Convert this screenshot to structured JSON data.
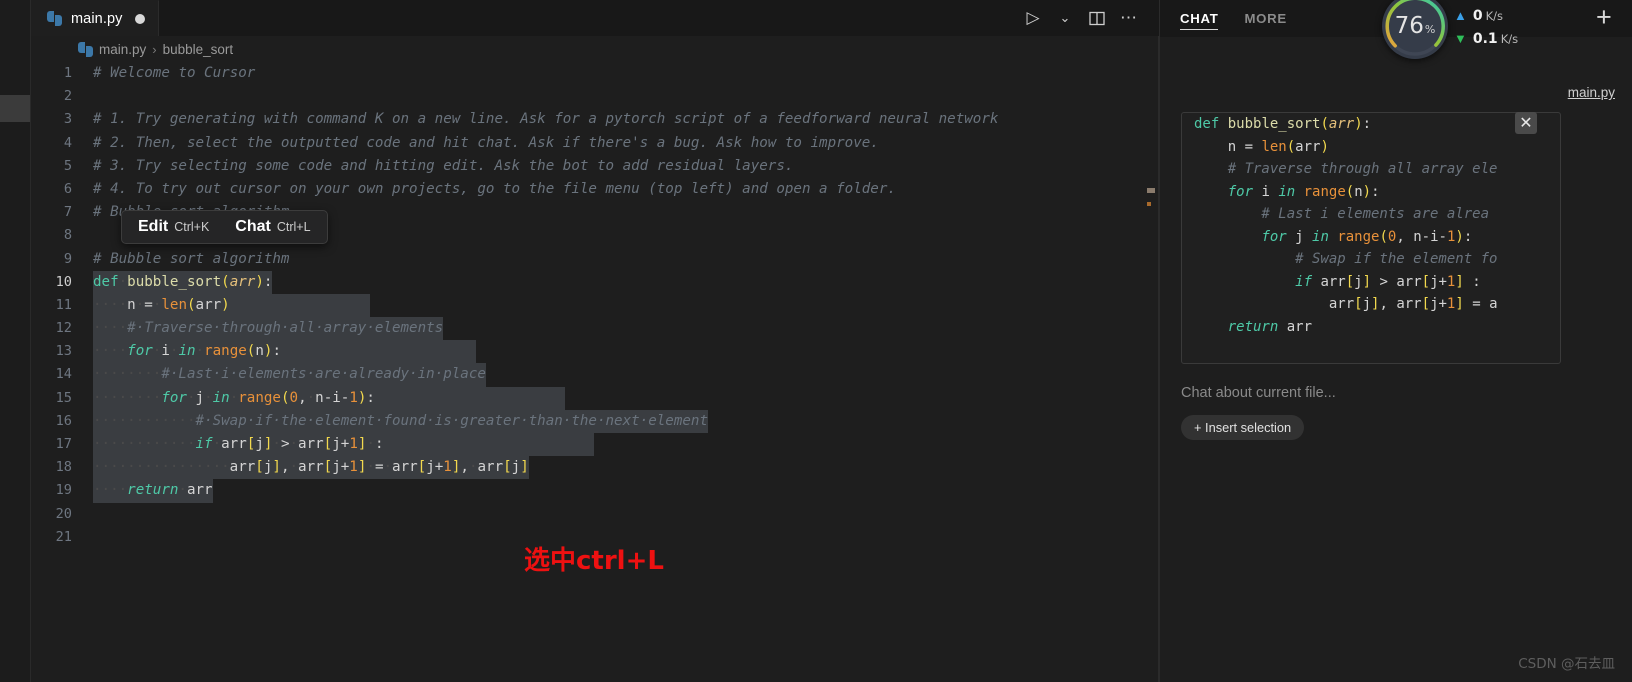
{
  "tab": {
    "label": "main.py",
    "icon": "python-file-icon",
    "dirty": true
  },
  "tabbar_actions": [
    {
      "name": "run-button",
      "glyph": "▷"
    },
    {
      "name": "chevron-down-icon",
      "glyph": "⌄"
    },
    {
      "name": "split-editor-icon",
      "glyph": "▥"
    },
    {
      "name": "more-actions-icon",
      "glyph": "⋯"
    }
  ],
  "breadcrumb": {
    "file": "main.py",
    "separator": "›",
    "symbol": "bubble_sort"
  },
  "editor": {
    "lines": [
      {
        "n": "1",
        "segs": [
          {
            "t": "# Welcome to Cursor",
            "c": "c-com"
          }
        ]
      },
      {
        "n": "2",
        "segs": []
      },
      {
        "n": "3",
        "segs": [
          {
            "t": "# 1. Try generating with command K on a new line. Ask for a pytorch script of a feedforward neural network",
            "c": "c-com"
          }
        ]
      },
      {
        "n": "4",
        "segs": [
          {
            "t": "# 2. Then, select the outputted code and hit chat. Ask if there's a bug. Ask how to improve.",
            "c": "c-com"
          }
        ]
      },
      {
        "n": "5",
        "segs": [
          {
            "t": "# 3. Try selecting some code and hitting edit. Ask the bot to add residual layers.",
            "c": "c-com"
          }
        ]
      },
      {
        "n": "6",
        "segs": [
          {
            "t": "# 4. To try out cursor on your own projects, go to the file menu (top left) and open a folder.",
            "c": "c-com"
          }
        ]
      },
      {
        "n": "7",
        "segs": [
          {
            "t": "# Bubble sort algorithm",
            "c": "c-com"
          }
        ]
      },
      {
        "n": "8",
        "segs": []
      },
      {
        "n": "9",
        "segs": [
          {
            "t": "# Bubble sort algorithm",
            "c": "c-com"
          }
        ]
      },
      {
        "n": "10",
        "current": true,
        "sel": true,
        "segs": [
          {
            "t": "def",
            "c": "c-def"
          },
          {
            "t": "·",
            "c": "ws"
          },
          {
            "t": "bubble_sort",
            "c": "c-fn"
          },
          {
            "t": "(",
            "c": "c-brk"
          },
          {
            "t": "arr",
            "c": "c-param"
          },
          {
            "t": ")",
            "c": "c-brk"
          },
          {
            "t": ":",
            "c": "c-plain"
          }
        ]
      },
      {
        "n": "11",
        "sel": true,
        "selpad": 140,
        "segs": [
          {
            "t": "····",
            "c": "ws"
          },
          {
            "t": "n",
            "c": "c-plain"
          },
          {
            "t": "·",
            "c": "ws"
          },
          {
            "t": "=",
            "c": "c-op"
          },
          {
            "t": "·",
            "c": "ws"
          },
          {
            "t": "len",
            "c": "c-builtin"
          },
          {
            "t": "(",
            "c": "c-brk"
          },
          {
            "t": "arr",
            "c": "c-plain"
          },
          {
            "t": ")",
            "c": "c-brk"
          }
        ]
      },
      {
        "n": "12",
        "sel": true,
        "segs": [
          {
            "t": "····",
            "c": "ws"
          },
          {
            "t": "#·Traverse·through·all·array·elements",
            "c": "c-com"
          }
        ]
      },
      {
        "n": "13",
        "sel": true,
        "selpad": 195,
        "segs": [
          {
            "t": "····",
            "c": "ws"
          },
          {
            "t": "for",
            "c": "c-kw"
          },
          {
            "t": "·",
            "c": "ws"
          },
          {
            "t": "i",
            "c": "c-plain"
          },
          {
            "t": "·",
            "c": "ws"
          },
          {
            "t": "in",
            "c": "c-kw"
          },
          {
            "t": "·",
            "c": "ws"
          },
          {
            "t": "range",
            "c": "c-builtin"
          },
          {
            "t": "(",
            "c": "c-brk"
          },
          {
            "t": "n",
            "c": "c-plain"
          },
          {
            "t": ")",
            "c": "c-brk"
          },
          {
            "t": ":",
            "c": "c-plain"
          }
        ]
      },
      {
        "n": "14",
        "sel": true,
        "segs": [
          {
            "t": "········",
            "c": "ws"
          },
          {
            "t": "#·Last·i·elements·are·already·in·place",
            "c": "c-com"
          }
        ]
      },
      {
        "n": "15",
        "sel": true,
        "selpad": 190,
        "segs": [
          {
            "t": "········",
            "c": "ws"
          },
          {
            "t": "for",
            "c": "c-kw"
          },
          {
            "t": "·",
            "c": "ws"
          },
          {
            "t": "j",
            "c": "c-plain"
          },
          {
            "t": "·",
            "c": "ws"
          },
          {
            "t": "in",
            "c": "c-kw"
          },
          {
            "t": "·",
            "c": "ws"
          },
          {
            "t": "range",
            "c": "c-builtin"
          },
          {
            "t": "(",
            "c": "c-brk"
          },
          {
            "t": "0",
            "c": "c-num"
          },
          {
            "t": ",",
            "c": "c-plain"
          },
          {
            "t": "·",
            "c": "ws"
          },
          {
            "t": "n-i-",
            "c": "c-plain"
          },
          {
            "t": "1",
            "c": "c-num"
          },
          {
            "t": ")",
            "c": "c-brk"
          },
          {
            "t": ":",
            "c": "c-plain"
          }
        ]
      },
      {
        "n": "16",
        "sel": true,
        "segs": [
          {
            "t": "············",
            "c": "ws"
          },
          {
            "t": "#·Swap·if·the·element·found·is·greater·than·the·next·element",
            "c": "c-com"
          }
        ]
      },
      {
        "n": "17",
        "sel": true,
        "selpad": 210,
        "segs": [
          {
            "t": "············",
            "c": "ws"
          },
          {
            "t": "if",
            "c": "c-kw"
          },
          {
            "t": "·",
            "c": "ws"
          },
          {
            "t": "arr",
            "c": "c-plain"
          },
          {
            "t": "[",
            "c": "c-brk"
          },
          {
            "t": "j",
            "c": "c-plain"
          },
          {
            "t": "]",
            "c": "c-brk"
          },
          {
            "t": "·",
            "c": "ws"
          },
          {
            "t": ">",
            "c": "c-op"
          },
          {
            "t": "·",
            "c": "ws"
          },
          {
            "t": "arr",
            "c": "c-plain"
          },
          {
            "t": "[",
            "c": "c-brk"
          },
          {
            "t": "j+",
            "c": "c-plain"
          },
          {
            "t": "1",
            "c": "c-num"
          },
          {
            "t": "]",
            "c": "c-brk"
          },
          {
            "t": "·",
            "c": "ws"
          },
          {
            "t": ":",
            "c": "c-plain"
          }
        ]
      },
      {
        "n": "18",
        "sel": true,
        "segs": [
          {
            "t": "················",
            "c": "ws"
          },
          {
            "t": "arr",
            "c": "c-plain"
          },
          {
            "t": "[",
            "c": "c-brk"
          },
          {
            "t": "j",
            "c": "c-plain"
          },
          {
            "t": "]",
            "c": "c-brk"
          },
          {
            "t": ",",
            "c": "c-plain"
          },
          {
            "t": "·",
            "c": "ws"
          },
          {
            "t": "arr",
            "c": "c-plain"
          },
          {
            "t": "[",
            "c": "c-brk"
          },
          {
            "t": "j+",
            "c": "c-plain"
          },
          {
            "t": "1",
            "c": "c-num"
          },
          {
            "t": "]",
            "c": "c-brk"
          },
          {
            "t": "·",
            "c": "ws"
          },
          {
            "t": "=",
            "c": "c-op"
          },
          {
            "t": "·",
            "c": "ws"
          },
          {
            "t": "arr",
            "c": "c-plain"
          },
          {
            "t": "[",
            "c": "c-brk"
          },
          {
            "t": "j+",
            "c": "c-plain"
          },
          {
            "t": "1",
            "c": "c-num"
          },
          {
            "t": "]",
            "c": "c-brk"
          },
          {
            "t": ",",
            "c": "c-plain"
          },
          {
            "t": "·",
            "c": "ws"
          },
          {
            "t": "arr",
            "c": "c-plain"
          },
          {
            "t": "[",
            "c": "c-brk"
          },
          {
            "t": "j",
            "c": "c-plain"
          },
          {
            "t": "]",
            "c": "c-brk"
          }
        ]
      },
      {
        "n": "19",
        "sel": true,
        "segs": [
          {
            "t": "····",
            "c": "ws"
          },
          {
            "t": "return",
            "c": "c-kw"
          },
          {
            "t": "·",
            "c": "ws"
          },
          {
            "t": "arr",
            "c": "c-plain"
          }
        ]
      },
      {
        "n": "20",
        "segs": []
      },
      {
        "n": "21",
        "segs": []
      }
    ]
  },
  "hover_widget": {
    "edit_label": "Edit",
    "edit_kbd": "Ctrl+K",
    "chat_label": "Chat",
    "chat_kbd": "Ctrl+L"
  },
  "annotation": {
    "text": "选中ctrl+L",
    "color": "#ee1111"
  },
  "right_panel": {
    "tabs": [
      {
        "label": "CHAT",
        "active": true
      },
      {
        "label": "MORE",
        "active": false
      }
    ],
    "file_ref": "main.py",
    "close_glyph": "✕",
    "code_card": [
      [
        {
          "t": "def",
          "c": "c-def"
        },
        {
          "t": " ",
          "c": "c-plain"
        },
        {
          "t": "bubble_sort",
          "c": "c-fn"
        },
        {
          "t": "(",
          "c": "c-brk"
        },
        {
          "t": "arr",
          "c": "c-param"
        },
        {
          "t": ")",
          "c": "c-brk"
        },
        {
          "t": ":",
          "c": "c-plain"
        }
      ],
      [
        {
          "t": "    n = ",
          "c": "c-plain"
        },
        {
          "t": "len",
          "c": "c-builtin"
        },
        {
          "t": "(",
          "c": "c-brk"
        },
        {
          "t": "arr",
          "c": "c-plain"
        },
        {
          "t": ")",
          "c": "c-brk"
        }
      ],
      [
        {
          "t": "    # Traverse through all array ele",
          "c": "c-com"
        }
      ],
      [
        {
          "t": "    ",
          "c": "c-plain"
        },
        {
          "t": "for",
          "c": "c-kw"
        },
        {
          "t": " i ",
          "c": "c-plain"
        },
        {
          "t": "in",
          "c": "c-kw"
        },
        {
          "t": " ",
          "c": "c-plain"
        },
        {
          "t": "range",
          "c": "c-builtin"
        },
        {
          "t": "(",
          "c": "c-brk"
        },
        {
          "t": "n",
          "c": "c-plain"
        },
        {
          "t": ")",
          "c": "c-brk"
        },
        {
          "t": ":",
          "c": "c-plain"
        }
      ],
      [
        {
          "t": "        # Last i elements are alrea",
          "c": "c-com"
        }
      ],
      [
        {
          "t": "        ",
          "c": "c-plain"
        },
        {
          "t": "for",
          "c": "c-kw"
        },
        {
          "t": " j ",
          "c": "c-plain"
        },
        {
          "t": "in",
          "c": "c-kw"
        },
        {
          "t": " ",
          "c": "c-plain"
        },
        {
          "t": "range",
          "c": "c-builtin"
        },
        {
          "t": "(",
          "c": "c-brk"
        },
        {
          "t": "0",
          "c": "c-num"
        },
        {
          "t": ", n-i-",
          "c": "c-plain"
        },
        {
          "t": "1",
          "c": "c-num"
        },
        {
          "t": ")",
          "c": "c-brk"
        },
        {
          "t": ":",
          "c": "c-plain"
        }
      ],
      [
        {
          "t": "            # Swap if the element fo",
          "c": "c-com"
        }
      ],
      [
        {
          "t": "            ",
          "c": "c-plain"
        },
        {
          "t": "if",
          "c": "c-kw"
        },
        {
          "t": " arr",
          "c": "c-plain"
        },
        {
          "t": "[",
          "c": "c-brk"
        },
        {
          "t": "j",
          "c": "c-plain"
        },
        {
          "t": "]",
          "c": "c-brk"
        },
        {
          "t": " > arr",
          "c": "c-plain"
        },
        {
          "t": "[",
          "c": "c-brk"
        },
        {
          "t": "j+",
          "c": "c-plain"
        },
        {
          "t": "1",
          "c": "c-num"
        },
        {
          "t": "]",
          "c": "c-brk"
        },
        {
          "t": " :",
          "c": "c-plain"
        }
      ],
      [
        {
          "t": "                arr",
          "c": "c-plain"
        },
        {
          "t": "[",
          "c": "c-brk"
        },
        {
          "t": "j",
          "c": "c-plain"
        },
        {
          "t": "]",
          "c": "c-brk"
        },
        {
          "t": ", arr",
          "c": "c-plain"
        },
        {
          "t": "[",
          "c": "c-brk"
        },
        {
          "t": "j+",
          "c": "c-plain"
        },
        {
          "t": "1",
          "c": "c-num"
        },
        {
          "t": "]",
          "c": "c-brk"
        },
        {
          "t": " = a",
          "c": "c-plain"
        }
      ],
      [
        {
          "t": "    ",
          "c": "c-plain"
        },
        {
          "t": "return",
          "c": "c-kw"
        },
        {
          "t": " arr",
          "c": "c-plain"
        }
      ]
    ],
    "chat_placeholder": "Chat about current file...",
    "insert_selection_label": "+ Insert selection"
  },
  "monitor": {
    "percent": "76",
    "percent_unit": "%",
    "upload_value": "0",
    "upload_unit": "K/s",
    "download_value": "0.1",
    "download_unit": "K/s",
    "add_glyph": "+",
    "ring_colors": {
      "start": "#e8a33d",
      "mid": "#8fc63d",
      "end": "#2fc8b4"
    }
  },
  "watermark": "CSDN @石去皿"
}
